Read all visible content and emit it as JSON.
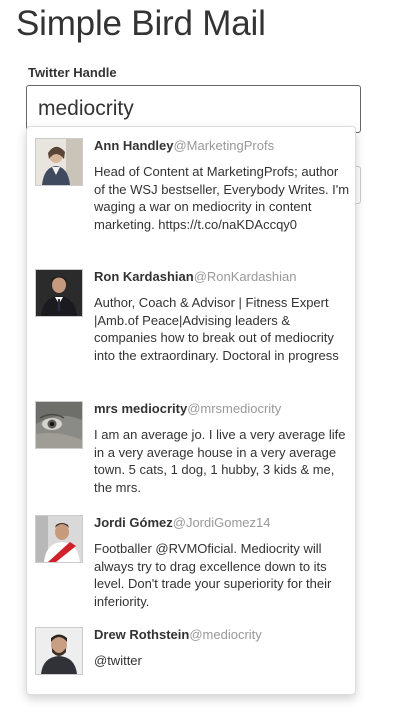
{
  "app": {
    "title": "Simple Bird Mail"
  },
  "form": {
    "label": "Twitter Handle",
    "input_value": "mediocrity"
  },
  "suggestions": [
    {
      "name": "Ann Handley",
      "handle": "@MarketingProfs",
      "bio": "Head of Content at MarketingProfs; author of the WSJ bestseller, Everybody Writes. I'm waging a war on mediocrity in content marketing. https://t.co/naKDAccqy0"
    },
    {
      "name": "Ron Kardashian",
      "handle": "@RonKardashian",
      "bio": "Author, Coach & Advisor | Fitness Expert |Amb.of Peace|Advising leaders & companies how to break out of mediocrity into the extraordinary. Doctoral in progress"
    },
    {
      "name": "mrs mediocrity",
      "handle": "@mrsmediocrity",
      "bio": "I am an average jo. I live a very average life in a very average house in a very average town. 5 cats, 1 dog, 1 hubby, 3 kids & me, the mrs."
    },
    {
      "name": "Jordi Gómez",
      "handle": "@JordiGomez14",
      "bio": "Footballer @RVMOficial. Mediocrity will always try to drag excellence down to its level. Don't trade your superiority for their inferiority."
    },
    {
      "name": "Drew Rothstein",
      "handle": "@mediocrity",
      "bio": "@twitter"
    }
  ]
}
